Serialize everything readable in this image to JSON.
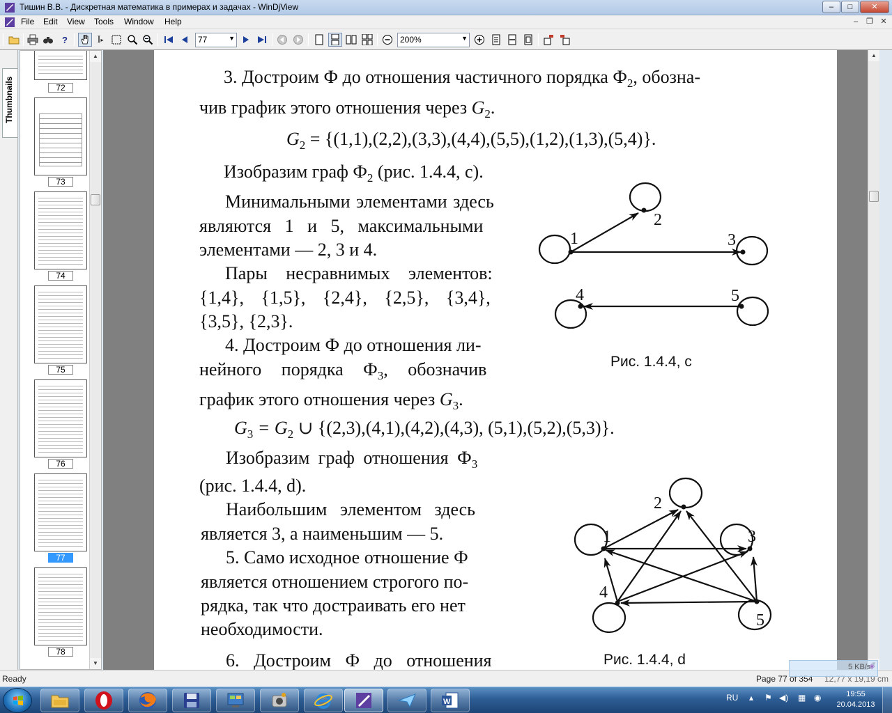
{
  "window": {
    "title": "Тишин В.В. - Дискретная математика в примерах и задачах - WinDjView",
    "btn_min": "–",
    "btn_max": "□",
    "btn_close": "✕"
  },
  "menu": {
    "items": [
      "File",
      "Edit",
      "View",
      "Tools",
      "Window",
      "Help"
    ],
    "mdi_min": "–",
    "mdi_restore": "❐",
    "mdi_close": "✕"
  },
  "toolbar": {
    "page_value": "77",
    "zoom_value": "200%"
  },
  "sidebar": {
    "tab_label": "Thumbnails",
    "thumbnails": [
      {
        "num": "72",
        "selected": false
      },
      {
        "num": "73",
        "selected": false
      },
      {
        "num": "74",
        "selected": false
      },
      {
        "num": "75",
        "selected": false
      },
      {
        "num": "76",
        "selected": false
      },
      {
        "num": "77",
        "selected": true
      },
      {
        "num": "78",
        "selected": false
      }
    ]
  },
  "document": {
    "p3_line1_a": "3. Достроим Ф до отношения частичного порядка Ф",
    "p3_line1_sub": "2",
    "p3_line1_b": ", обозна-",
    "p3_line2": "чив график этого отношения через",
    "p3_line2_sym": "G",
    "p3_line2_sub": "2",
    "p3_line2_end": ".",
    "formula_g2_lhs": "G",
    "formula_g2_sub": "2",
    "formula_g2_rhs": " = {(1,1),(2,2),(3,3),(4,4),(5,5),(1,2),(1,3),(5,4)}.",
    "draw_c_a": "Изобразим граф Ф",
    "draw_c_sub": "2",
    "draw_c_b": " (рис. 1.4.4, c).",
    "min_line1": "Минимальными элементами здесь",
    "min_line2": "являются 1 и 5, максимальными",
    "min_line3": "элементами — 2, 3 и 4.",
    "pairs_line1": "Пары несравнимых элементов:",
    "pairs_line2": "{1,4}, {1,5}, {2,4}, {2,5}, {3,4},",
    "pairs_line3": "{3,5}, {2,3}.",
    "p4_line1": "4. Достроим Ф до отношения ли-",
    "p4_line2_a": "нейного порядка Ф",
    "p4_line2_sub": "3",
    "p4_line2_b": ", обозначив",
    "p4_line3": "график этого отношения через",
    "p4_line3_sym": "G",
    "p4_line3_sub": "3",
    "p4_line3_end": ".",
    "formula_g3_a": "G",
    "formula_g3_sub_a": "3",
    "formula_g3_b": " = G",
    "formula_g3_sub_b": "2",
    "formula_g3_rhs": " ∪ {(2,3),(4,1),(4,2),(4,3), (5,1),(5,2),(5,3)}.",
    "draw_d_a": "Изобразим граф отношения Ф",
    "draw_d_sub": "3",
    "draw_d_b": "(рис. 1.4.4, d).",
    "max_line1": "Наибольшим элементом здесь",
    "max_line2": "является 3, а наименьшим — 5.",
    "p5_line1": "5. Само исходное отношение Ф",
    "p5_line2": "является отношением строгого по-",
    "p5_line3": "рядка, так что достраивать его нет",
    "p5_line4": "необходимости.",
    "p6_line1": "6. Достроим Ф до отношения",
    "caption_c": "Рис. 1.4.4, c",
    "caption_d": "Рис. 1.4.4, d",
    "graph_c_labels": [
      "1",
      "2",
      "3",
      "4",
      "5"
    ],
    "graph_d_labels": [
      "1",
      "2",
      "3",
      "4",
      "5"
    ]
  },
  "statusbar": {
    "ready": "Ready",
    "page_info": "Page 77 of 354",
    "page_size": "12,77 x 19,19 cm",
    "net_speed": "5 KB/s"
  },
  "taskbar": {
    "lang": "RU",
    "time": "19:55",
    "date": "20.04.2013"
  }
}
